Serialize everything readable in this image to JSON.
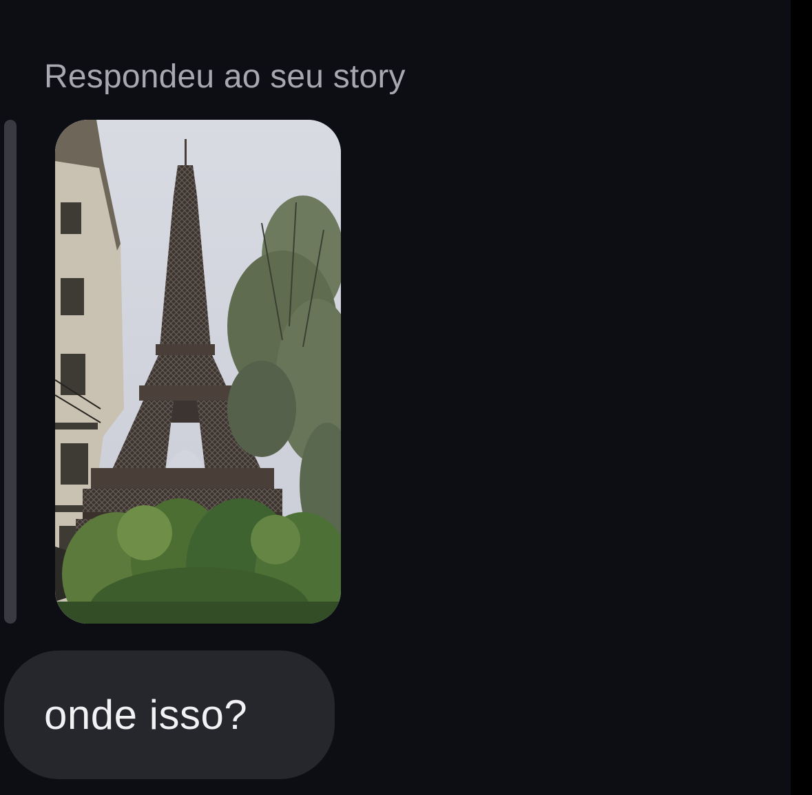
{
  "conversation": {
    "reply_label": "Respondeu ao seu story",
    "story_preview": {
      "subject": "eiffel-tower-photo"
    },
    "message": {
      "text": "onde isso?"
    }
  },
  "colors": {
    "background": "#0d0e14",
    "bubble": "#26272d",
    "header_text": "#a8a9b0",
    "message_text": "#f2f2f5",
    "quote_bar": "#3a3b42"
  }
}
